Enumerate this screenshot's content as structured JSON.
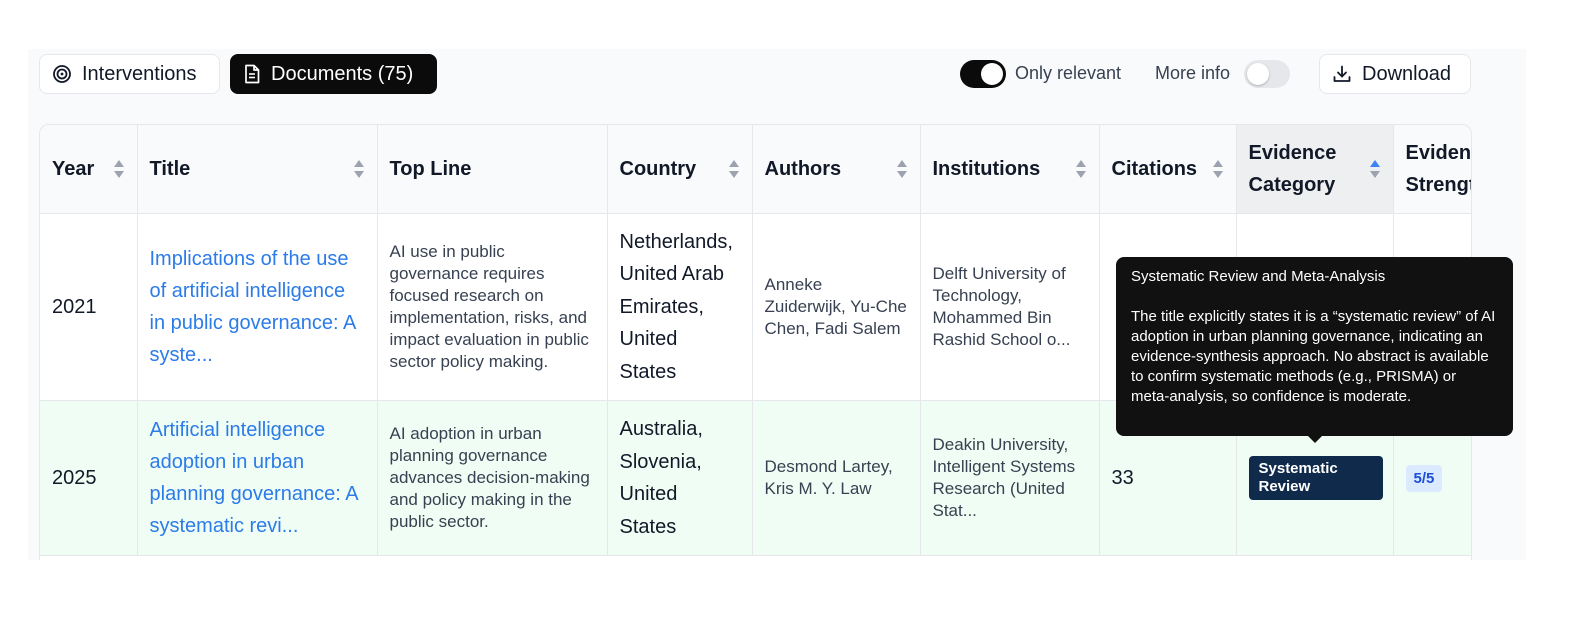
{
  "toolbar": {
    "interventions_label": "Interventions",
    "documents_label": "Documents (75)",
    "only_relevant_label": "Only relevant",
    "only_relevant_on": true,
    "more_info_label": "More info",
    "more_info_on": false,
    "download_label": "Download"
  },
  "columns": {
    "year": "Year",
    "title": "Title",
    "top_line": "Top Line",
    "country": "Country",
    "authors": "Authors",
    "institutions": "Institutions",
    "citations": "Citations",
    "evidence_category": "Evidence Category",
    "evidence_strength": "Evidence Strength"
  },
  "rows": [
    {
      "year": "2021",
      "title": "Implications of the use of artificial intelligence in public governance: A syste...",
      "top_line": "AI use in public governance requires focused research on implementation, risks, and impact evaluation in public sector policy making.",
      "country": "Netherlands, United Arab Emirates, United States",
      "authors": "Anneke Zuiderwijk, Yu-Che Chen, Fadi Salem",
      "institutions": "Delft University of Technology, Mohammed Bin Rashid School o...",
      "citations": "",
      "evidence_category": "",
      "evidence_strength": ""
    },
    {
      "year": "2025",
      "title": "Artificial intelligence adoption in urban planning governance: A systematic revi...",
      "top_line": "AI adoption in urban planning governance advances decision-making and policy making in the public sector.",
      "country": "Australia, Slovenia, United States",
      "authors": "Desmond Lartey, Kris M. Y. Law",
      "institutions": "Deakin University, Intelligent Systems Research (United Stat...",
      "citations": "33",
      "evidence_category": "Systematic Review",
      "evidence_strength": "5/5"
    }
  ],
  "tooltip": {
    "title": "Systematic Review and Meta-Analysis",
    "body": "The title explicitly states it is a “systematic review” of AI adoption in urban planning governance, indicating an evidence-synthesis approach. No abstract is available to confirm systematic methods (e.g., PRISMA) or meta-analysis, so confidence is moderate."
  },
  "colors": {
    "link": "#2b7be9",
    "badge_category": "#0f2a4a",
    "badge_strength_bg": "#dbeafe",
    "highlight_row": "#f0fdf4",
    "sort_active": "#3b82f6"
  }
}
